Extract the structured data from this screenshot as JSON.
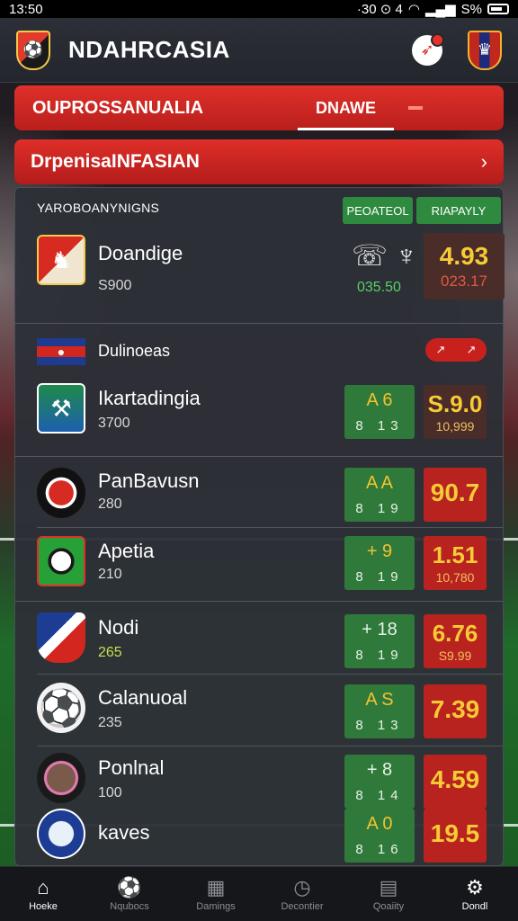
{
  "status_bar": {
    "time": "13:50",
    "indicators": "·30 ⊙ 4",
    "battery": "S%"
  },
  "header": {
    "title": "NDAHRCASIA"
  },
  "tabs": {
    "main": "OUPROSSANUALIA",
    "second": "DNAWE"
  },
  "section": {
    "title": "DrpenisaINFASIAN",
    "chevron": "›"
  },
  "featured": {
    "column_label": "YAROBOANYNIGNS",
    "pill_left": "PEOATEOL",
    "pill_right": "RIAPAYLY",
    "team": "Doandige",
    "sub": "S900",
    "odds_sub": "035.50",
    "price": "4.93",
    "price_sub": "023.17"
  },
  "league": {
    "name": "Dulinoeas"
  },
  "matches": [
    {
      "name": "Ikartadingia",
      "sub": "3700",
      "odds_top": "A  6",
      "odds_bot": "8 13",
      "price": "S.9.0",
      "price_sub": "10,999"
    },
    {
      "name": "PanBavusn",
      "sub": "280",
      "odds_top": "A  A",
      "odds_bot": "8 19",
      "price": "90.7",
      "price_sub": ""
    },
    {
      "name": "Apetia",
      "sub": "210",
      "odds_top": "+ 9",
      "odds_bot": "8 19",
      "price": "1.51",
      "price_sub": "10,780"
    },
    {
      "name": "Nodi",
      "sub": "265",
      "odds_top": "+ 18",
      "odds_bot": "8 19",
      "price": "6.76",
      "price_sub": "S9.99"
    },
    {
      "name": "Calanuoal",
      "sub": "235",
      "odds_top": "A  S",
      "odds_bot": "8 13",
      "price": "7.39",
      "price_sub": ""
    },
    {
      "name": "Ponlnal",
      "sub": "100",
      "odds_top": "+ 8",
      "odds_bot": "8 14",
      "price": "4.59",
      "price_sub": ""
    },
    {
      "name": "kaves",
      "sub": "",
      "odds_top": "A 0",
      "odds_bot": "8 16",
      "price": "19.5",
      "price_sub": ""
    }
  ],
  "nav": [
    {
      "label": "Hoeke",
      "icon": "home-icon",
      "active": true
    },
    {
      "label": "Nqubocs",
      "icon": "ball-icon",
      "active": false
    },
    {
      "label": "Damings",
      "icon": "calendar-icon",
      "active": false
    },
    {
      "label": "Decontier",
      "icon": "clock-icon",
      "active": false
    },
    {
      "label": "Qoaiity",
      "icon": "ticket-icon",
      "active": false
    },
    {
      "label": "Dondl",
      "icon": "gear-icon",
      "active": true
    }
  ],
  "colors": {
    "accent_red": "#d42a22",
    "odds_green": "#2f7a3a",
    "price_gold": "#f6cb36"
  }
}
